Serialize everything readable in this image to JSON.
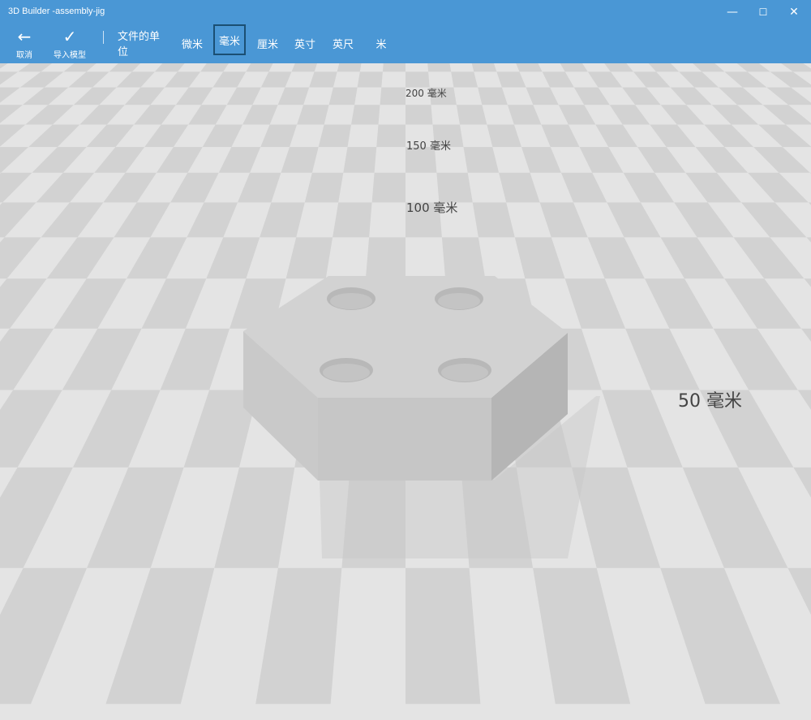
{
  "window": {
    "title": "3D Builder -assembly-jig",
    "minimize_glyph": "—",
    "maximize_glyph": "☐",
    "close_glyph": "✕"
  },
  "toolbar": {
    "cancel": {
      "icon": "arrow-left-icon",
      "glyph": "←",
      "label": "取消"
    },
    "import": {
      "icon": "check-icon",
      "glyph": "✓",
      "label": "导入模型"
    },
    "units_label": "文件的单位",
    "units": [
      "微米",
      "毫米",
      "厘米",
      "英寸",
      "英尺",
      "米"
    ],
    "selected_unit": "毫米"
  },
  "scene": {
    "scale_labels": [
      "200 毫米",
      "150 毫米",
      "100 毫米",
      "50 毫米"
    ],
    "model": "hexagonal-block-with-four-holes"
  },
  "colors": {
    "accent": "#4a97d5",
    "selected_border": "#1b4f73",
    "floor_light": "#e4e4e4",
    "floor_dark": "#d2d2d2"
  }
}
